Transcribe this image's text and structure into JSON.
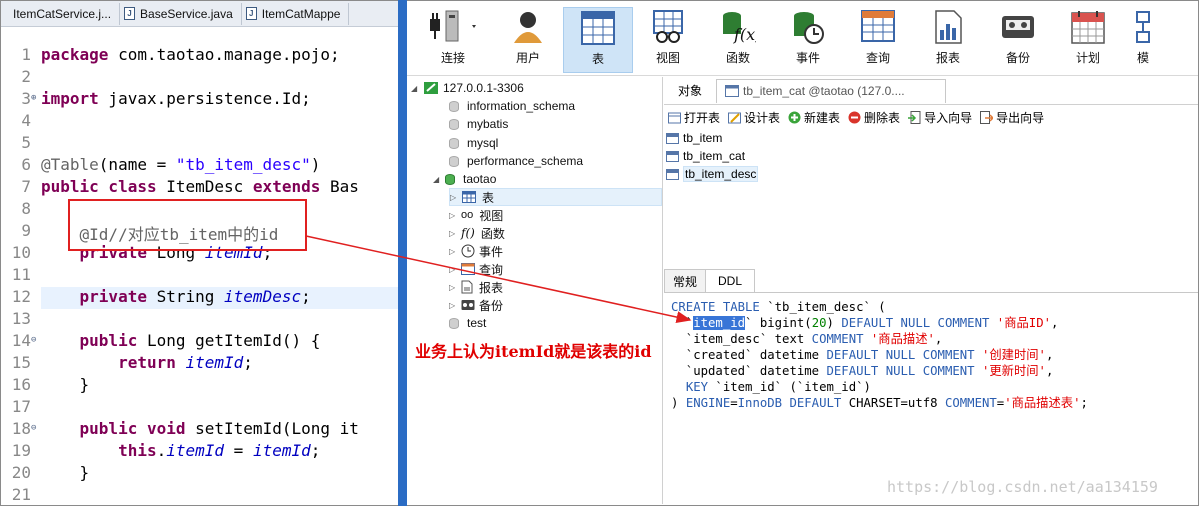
{
  "editor": {
    "tabs": [
      "ItemCatService.j...",
      "BaseService.java",
      "ItemCatMappe"
    ],
    "line_numbers": [
      "1",
      "2",
      "3",
      "4",
      "5",
      "6",
      "7",
      "8",
      "9",
      "10",
      "11",
      "12",
      "13",
      "14",
      "15",
      "16",
      "17",
      "18",
      "19",
      "20",
      "21"
    ],
    "code": {
      "l1_kw": "package",
      "l1_rest": " com.taotao.manage.pojo;",
      "l3_kw": "import",
      "l3_rest": " javax.persistence.Id;",
      "l6_ann": "@Table",
      "l6_a": "(name = ",
      "l6_str": "\"tb_item_desc\"",
      "l6_b": ")",
      "l7_kw1": "public class",
      "l7_a": " ItemDesc ",
      "l7_kw2": "extends",
      "l7_b": " Bas",
      "l9_ann": "@Id//对应tb_item中的id",
      "l10_kw": "private",
      "l10_a": " Long ",
      "l10_fld": "itemId",
      "l10_b": ";",
      "l12_kw": "private",
      "l12_a": " String ",
      "l12_fld": "itemDesc",
      "l12_b": ";",
      "l14_kw": "public",
      "l14_a": " Long getItemId() {",
      "l15_kw": "return",
      "l15_fld": "itemId",
      "l15_b": ";",
      "l16": "}",
      "l18_kw": "public void",
      "l18_a": " setItemId(Long it",
      "l19_kw": "this",
      "l19_a": ".",
      "l19_fld": "itemId",
      "l19_b": " = ",
      "l19_fld2": "itemId",
      "l19_c": ";",
      "l20": "}"
    }
  },
  "callout": "业务上认为itemId就是该表的id",
  "navicat": {
    "toolbar": [
      {
        "label": "连接",
        "icon": "connection-icon"
      },
      {
        "label": "用户",
        "icon": "user-icon"
      },
      {
        "label": "表",
        "icon": "table-icon"
      },
      {
        "label": "视图",
        "icon": "view-icon"
      },
      {
        "label": "函数",
        "icon": "function-icon"
      },
      {
        "label": "事件",
        "icon": "event-icon"
      },
      {
        "label": "查询",
        "icon": "query-icon"
      },
      {
        "label": "报表",
        "icon": "report-icon"
      },
      {
        "label": "备份",
        "icon": "backup-icon"
      },
      {
        "label": "计划",
        "icon": "schedule-icon"
      },
      {
        "label": "模",
        "icon": "model-icon"
      }
    ],
    "tree": {
      "connection": "127.0.0.1-3306",
      "databases": [
        "information_schema",
        "mybatis",
        "mysql",
        "performance_schema",
        "taotao"
      ],
      "taotao_children": [
        "表",
        "视图",
        "函数",
        "事件",
        "查询",
        "报表",
        "备份"
      ],
      "last_db": "test"
    },
    "object_tab": "对象",
    "object_path": "tb_item_cat @taotao (127.0....",
    "actions": [
      "打开表",
      "设计表",
      "新建表",
      "删除表",
      "导入向导",
      "导出向导"
    ],
    "tables": [
      "tb_item",
      "tb_item_cat",
      "tb_item_desc"
    ],
    "ddl_tabs": [
      "常规",
      "DDL"
    ],
    "ddl": {
      "l1_a": "CREATE TABLE",
      "l1_b": " `tb_item_desc` (",
      "l2_sel": "item_id",
      "l2_a": "` bigint(",
      "l2_n": "20",
      "l2_b": ") ",
      "l2_k": "DEFAULT NULL COMMENT",
      "l2_s": "'商品ID'",
      "l2_c": ",",
      "l3_a": "  `item_desc` text ",
      "l3_k": "COMMENT",
      "l3_s": "'商品描述'",
      "l3_c": ",",
      "l4_a": "  `created` datetime ",
      "l4_k": "DEFAULT NULL COMMENT",
      "l4_s": "'创建时间'",
      "l4_c": ",",
      "l5_a": "  `updated` datetime ",
      "l5_k": "DEFAULT NULL COMMENT",
      "l5_s": "'更新时间'",
      "l5_c": ",",
      "l6_k": "KEY",
      "l6_a": " `item_id` (`item_id`)",
      "l7_a": ") ",
      "l7_k1": "ENGINE",
      "l7_b": "=",
      "l7_k2": "InnoDB DEFAULT",
      "l7_c": " CHARSET=utf8 ",
      "l7_k3": "COMMENT",
      "l7_d": "=",
      "l7_s": "'商品描述表'",
      "l7_e": ";"
    }
  },
  "watermark": "https://blog.csdn.net/aa134159"
}
